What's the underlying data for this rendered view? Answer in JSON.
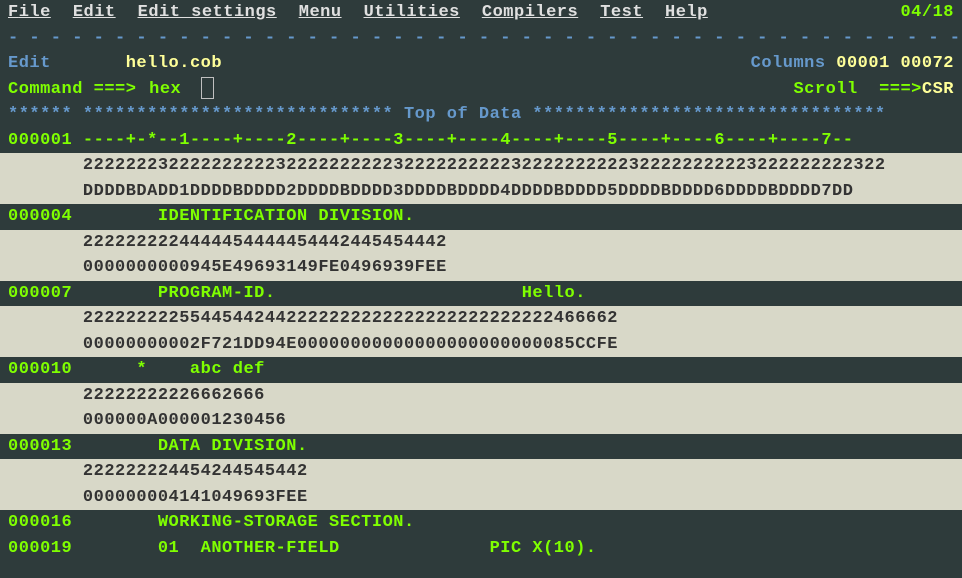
{
  "menu": {
    "items": [
      "File",
      "Edit",
      "Edit_settings",
      "Menu",
      "Utilities",
      "Compilers",
      "Test",
      "Help"
    ],
    "page": "04/18"
  },
  "header": {
    "mode": "Edit",
    "file": "hello.cob",
    "columns_label": "Columns",
    "col_start": "00001",
    "col_end": "00072"
  },
  "command": {
    "label": "Command ===> ",
    "value": "hex",
    "scroll_label": "Scroll  ===>",
    "scroll_value": "CSR"
  },
  "divider_dashes": "- - - - - - - - - - - - - - - - - - - - - - - - - - - - - - - - - - - - - - - - - - - - - -",
  "topdata": "****** ***************************** Top of Data *********************************",
  "lines": [
    {
      "no": "000001",
      "type": "code",
      "text": "----+-*--1----+----2----+----3----+----4----+----5----+----6----+----7--"
    },
    {
      "no": "      ",
      "type": "hex1",
      "text": "222222232222222222322222222223222222222232222222222322222222223222222222322"
    },
    {
      "no": "      ",
      "type": "hex2",
      "text": "DDDDBDADD1DDDDBDDDD2DDDDBDDDD3DDDDBDDDD4DDDDBDDDD5DDDDBDDDD6DDDDBDDDD7DD"
    },
    {
      "no": "000004",
      "type": "code",
      "text": "       IDENTIFICATION DIVISION."
    },
    {
      "no": "      ",
      "type": "hex1",
      "text": "2222222224444454444454442445454442"
    },
    {
      "no": "      ",
      "type": "hex2",
      "text": "0000000000945E49693149FE0496939FEE"
    },
    {
      "no": "000007",
      "type": "code",
      "text": "       PROGRAM-ID.                       Hello."
    },
    {
      "no": "      ",
      "type": "hex1",
      "text": "22222222255445442442222222222222222222222222466662"
    },
    {
      "no": "      ",
      "type": "hex2",
      "text": "00000000002F721DD94E00000000000000000000000085CCFE"
    },
    {
      "no": "000010",
      "type": "code",
      "text": "     *    abc def"
    },
    {
      "no": "      ",
      "type": "hex1",
      "text": "22222222226662666"
    },
    {
      "no": "      ",
      "type": "hex2",
      "text": "000000A000001230456"
    },
    {
      "no": "000013",
      "type": "code",
      "text": "       DATA DIVISION."
    },
    {
      "no": "      ",
      "type": "hex1",
      "text": "222222224454244545442"
    },
    {
      "no": "      ",
      "type": "hex2",
      "text": "000000004141049693FEE"
    },
    {
      "no": "000016",
      "type": "code",
      "text": "       WORKING-STORAGE SECTION."
    },
    {
      "no": "000019",
      "type": "code",
      "text": "       01  ANOTHER-FIELD              PIC X(10)."
    }
  ]
}
